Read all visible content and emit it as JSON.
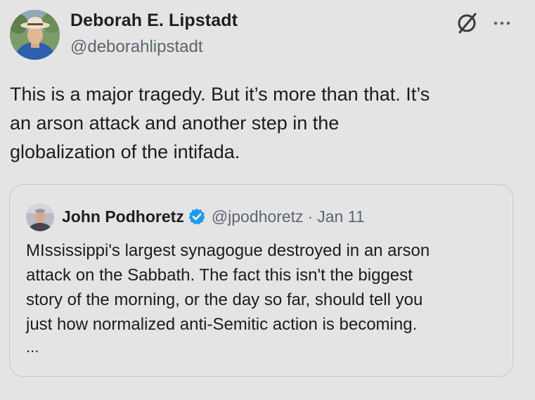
{
  "author": {
    "name": "Deborah E. Lipstadt",
    "handle": "@deborahlipstadt",
    "avatar_icon": "profile-photo"
  },
  "actions": {
    "grok_icon": "grok-icon",
    "more_icon": "more-options-icon",
    "more_label": "···"
  },
  "tweet": {
    "text": "This is a major tragedy.  But it’s more than that. It’s\nan arson attack and another step in the\nglobalization of the intifada."
  },
  "quote": {
    "name": "John Podhoretz",
    "verified_icon": "verified-badge-icon",
    "handle": "@jpodhoretz",
    "separator": "·",
    "date": "Jan 11",
    "text": "MIssissippi's largest synagogue destroyed in an arson\nattack on the Sabbath. The fact this isn't the biggest\nstory of the morning, or the day so far, should tell you\njust how normalized anti-Semitic action is becoming.",
    "truncation": "..."
  },
  "colors": {
    "background": "#e4e4e4",
    "text": "#1c1c1c",
    "secondary_text": "#5e6670",
    "verified_blue": "#1d9bf0",
    "border": "#c7c7c7"
  }
}
